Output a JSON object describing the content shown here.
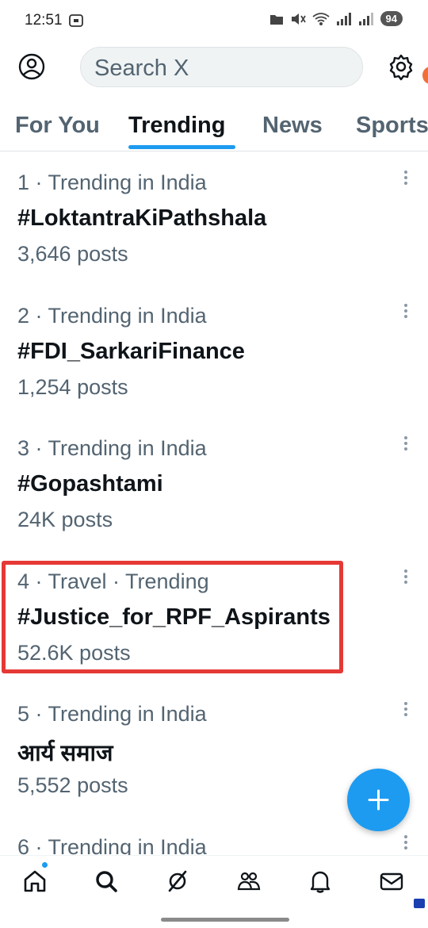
{
  "status_bar": {
    "time": "12:51",
    "battery": "94"
  },
  "search": {
    "placeholder": "Search X"
  },
  "tabs": [
    {
      "label": "For You",
      "active": false
    },
    {
      "label": "Trending",
      "active": true
    },
    {
      "label": "News",
      "active": false
    },
    {
      "label": "Sports",
      "active": false
    }
  ],
  "trends": [
    {
      "meta": "1 · Trending in India",
      "name": "#LoktantraKiPathshala",
      "count": "3,646 posts"
    },
    {
      "meta": "2 · Trending in India",
      "name": "#FDI_SarkariFinance",
      "count": "1,254 posts"
    },
    {
      "meta": "3 · Trending in India",
      "name": "#Gopashtami",
      "count": "24K posts"
    },
    {
      "meta": "4 · Travel · Trending",
      "name": "#Justice_for_RPF_Aspirants",
      "count": "52.6K posts",
      "highlighted": true
    },
    {
      "meta": "5 · Trending in India",
      "name": "आर्य समाज",
      "count": "5,552 posts"
    },
    {
      "meta": "6 · Trending in India",
      "name": "",
      "count": ""
    }
  ],
  "colors": {
    "accent": "#1d9bf0",
    "highlight": "#e53935",
    "secondary_text": "#536471"
  },
  "bottom_nav": [
    "home-icon",
    "search-icon",
    "grok-icon",
    "communities-icon",
    "notifications-icon",
    "messages-icon"
  ]
}
